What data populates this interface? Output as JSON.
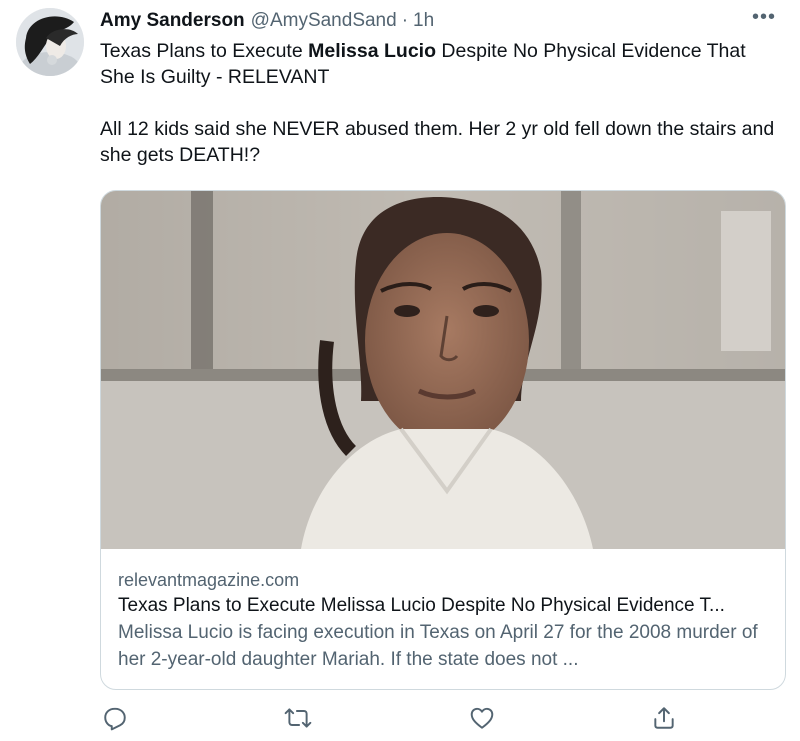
{
  "tweet": {
    "author": {
      "display_name": "Amy Sanderson",
      "handle": "@AmySandSand",
      "separator": "·",
      "time": "1h"
    },
    "more_label": "•••",
    "text": {
      "line1_prefix": "Texas Plans to Execute ",
      "line1_bold": "Melissa Lucio",
      "line1_suffix": " Despite No Physical Evidence That She Is Guilty - RELEVANT",
      "paragraph2": "All 12 kids said she NEVER abused them. Her 2 yr old fell down the stairs and she gets DEATH!?"
    },
    "card": {
      "domain": "relevantmagazine.com",
      "title": "Texas Plans to Execute Melissa Lucio Despite No Physical Evidence T...",
      "description": "Melissa Lucio is facing execution in Texas on April 27 for the 2008 murder of her 2-year-old daughter Mariah. If the state does not ..."
    },
    "actions": [
      {
        "name": "reply",
        "icon": "reply-icon"
      },
      {
        "name": "retweet",
        "icon": "retweet-icon"
      },
      {
        "name": "like",
        "icon": "heart-icon"
      },
      {
        "name": "share",
        "icon": "share-icon"
      }
    ],
    "colors": {
      "text_primary": "#0f1419",
      "text_secondary": "#536471",
      "border": "#cfd9de",
      "icon": "#536471"
    }
  }
}
